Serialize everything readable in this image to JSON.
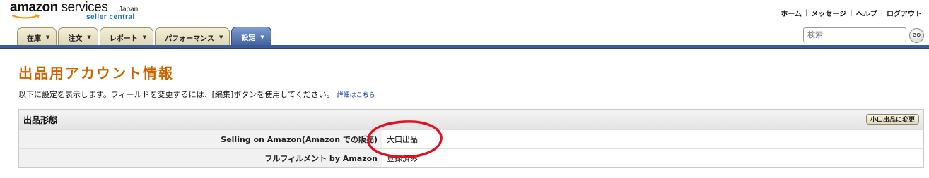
{
  "header": {
    "logo_main_a": "amazon",
    "logo_main_b": " services",
    "logo_region": "Japan",
    "logo_sub": "seller central",
    "links": [
      "ホーム",
      "メッセージ",
      "ヘルプ",
      "ログアウト"
    ],
    "separator": "|"
  },
  "search": {
    "placeholder": "検索",
    "go_label": "GO"
  },
  "tabs": [
    {
      "label": "在庫"
    },
    {
      "label": "注文"
    },
    {
      "label": "レポート"
    },
    {
      "label": "パフォーマンス"
    },
    {
      "label": "設定",
      "active": true
    }
  ],
  "tab_caret": "▼",
  "page": {
    "title": "出品用アカウント情報",
    "intro": "以下に設定を表示します。フィールドを変更するには、[編集]ボタンを使用してください。",
    "details_link": "詳細はこちら"
  },
  "panel": {
    "title": "出品形態",
    "change_button": "小口出品に変更",
    "rows": [
      {
        "label": "Selling on Amazon(Amazon での販売)",
        "value": "大口出品"
      },
      {
        "label": "フルフィルメント by Amazon",
        "value": "登録済み"
      }
    ]
  },
  "colors": {
    "title_orange": "#cc6600",
    "nav_blue": "#3b5a98",
    "annotation_red": "#e01020"
  }
}
